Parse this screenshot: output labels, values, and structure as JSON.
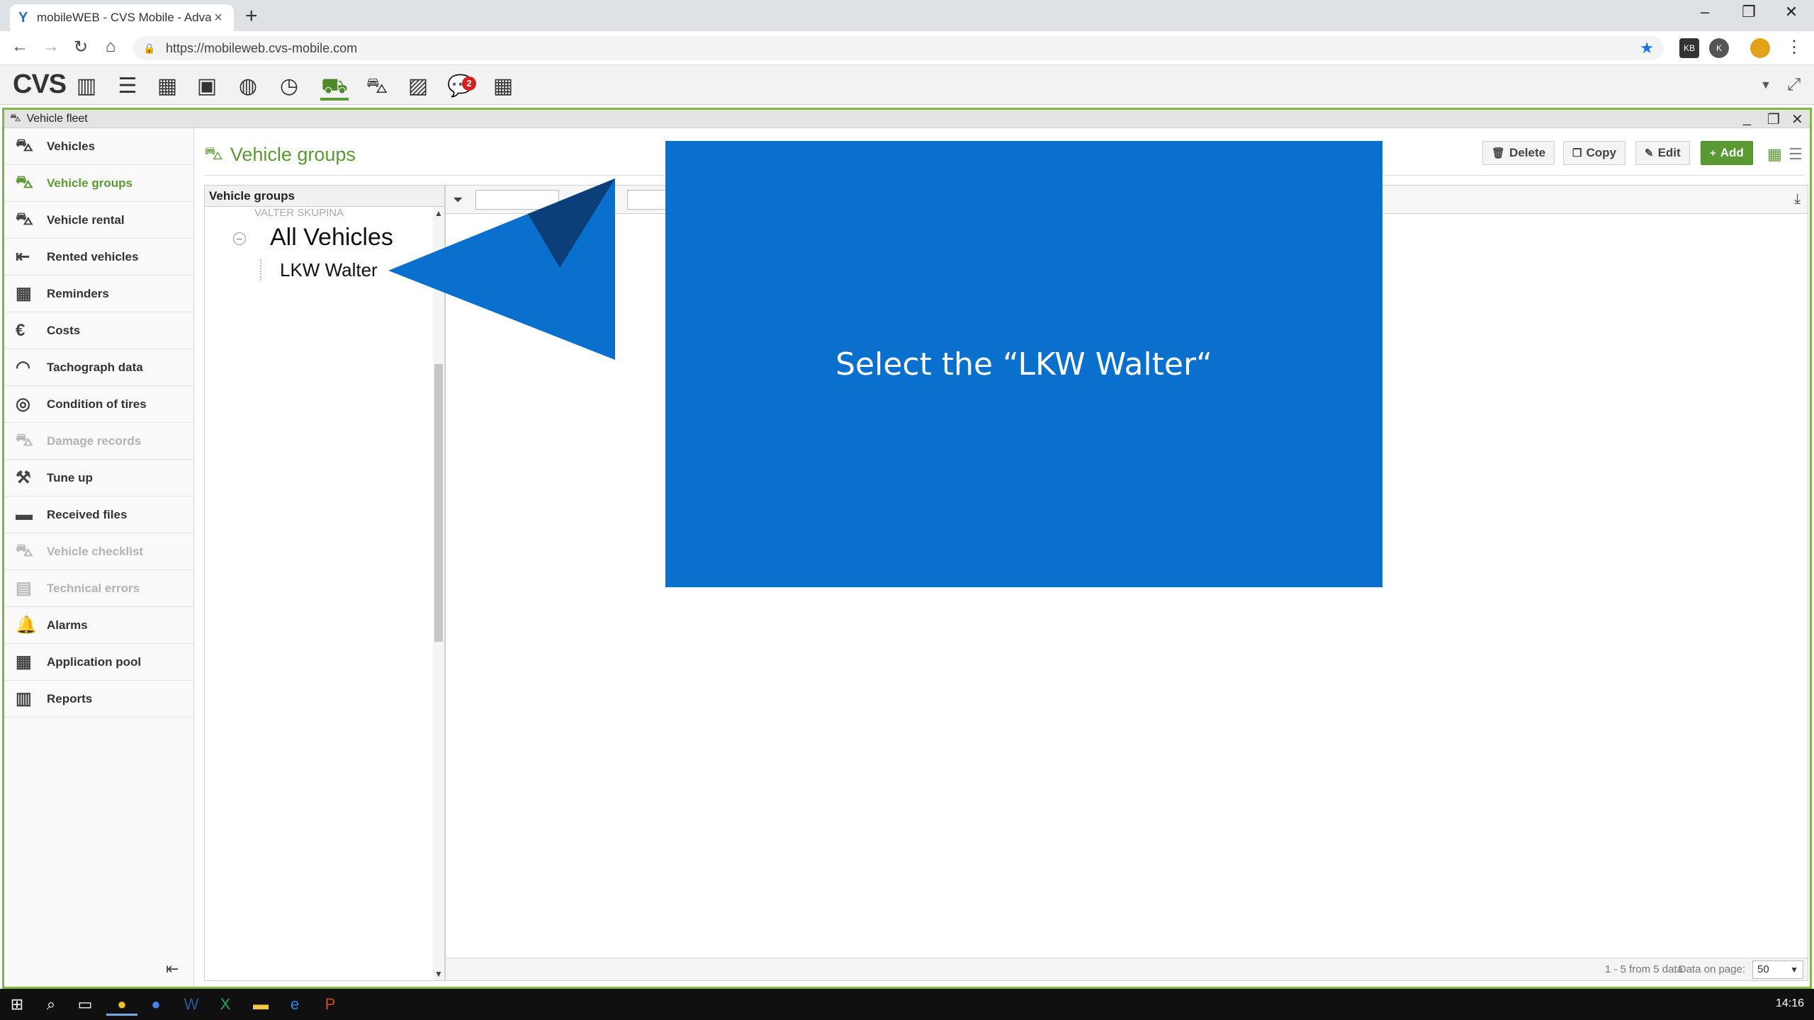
{
  "browser": {
    "tab_title": "mobileWEB - CVS Mobile - Advan",
    "url": "https://mobileweb.cvs-mobile.com",
    "ext1": "KB",
    "ext2": "K"
  },
  "app": {
    "logo": "CVS",
    "messages_badge": "2",
    "window_title": "Vehicle fleet"
  },
  "sidebar": {
    "items": [
      {
        "label": "Vehicles",
        "icon": "car-side-icon",
        "state": "normal"
      },
      {
        "label": "Vehicle groups",
        "icon": "car-group-icon",
        "state": "active"
      },
      {
        "label": "Vehicle rental",
        "icon": "car-rent-icon",
        "state": "normal"
      },
      {
        "label": "Rented vehicles",
        "icon": "car-return-icon",
        "state": "normal"
      },
      {
        "label": "Reminders",
        "icon": "calendar-icon",
        "state": "normal"
      },
      {
        "label": "Costs",
        "icon": "euro-icon",
        "state": "normal"
      },
      {
        "label": "Tachograph data",
        "icon": "gauge-icon",
        "state": "normal"
      },
      {
        "label": "Condition of tires",
        "icon": "tire-icon",
        "state": "normal"
      },
      {
        "label": "Damage records",
        "icon": "car-damage-icon",
        "state": "disabled"
      },
      {
        "label": "Tune up",
        "icon": "wrench-car-icon",
        "state": "normal"
      },
      {
        "label": "Received files",
        "icon": "folder-icon",
        "state": "normal"
      },
      {
        "label": "Vehicle checklist",
        "icon": "checklist-car-icon",
        "state": "disabled"
      },
      {
        "label": "Technical errors",
        "icon": "engine-icon",
        "state": "disabled"
      },
      {
        "label": "Alarms",
        "icon": "bell-icon",
        "state": "normal"
      },
      {
        "label": "Application pool",
        "icon": "apps-icon",
        "state": "normal"
      },
      {
        "label": "Reports",
        "icon": "bar-chart-icon",
        "state": "normal"
      }
    ]
  },
  "main": {
    "title": "Vehicle groups",
    "buttons": {
      "delete": "Delete",
      "copy": "Copy",
      "edit": "Edit",
      "add": "Add"
    },
    "tree": {
      "header": "Vehicle groups",
      "faded_node": "VALTER SKUPINA",
      "root": "All Vehicles",
      "child": "LKW Walter"
    },
    "footer": {
      "count": "1 - 5 from 5 data",
      "page_label": "Data on page:",
      "page_size": "50"
    }
  },
  "callout": {
    "text": "Select the “LKW Walter“",
    "color": "#0a70cd"
  },
  "taskbar": {
    "clock": "14:16"
  }
}
